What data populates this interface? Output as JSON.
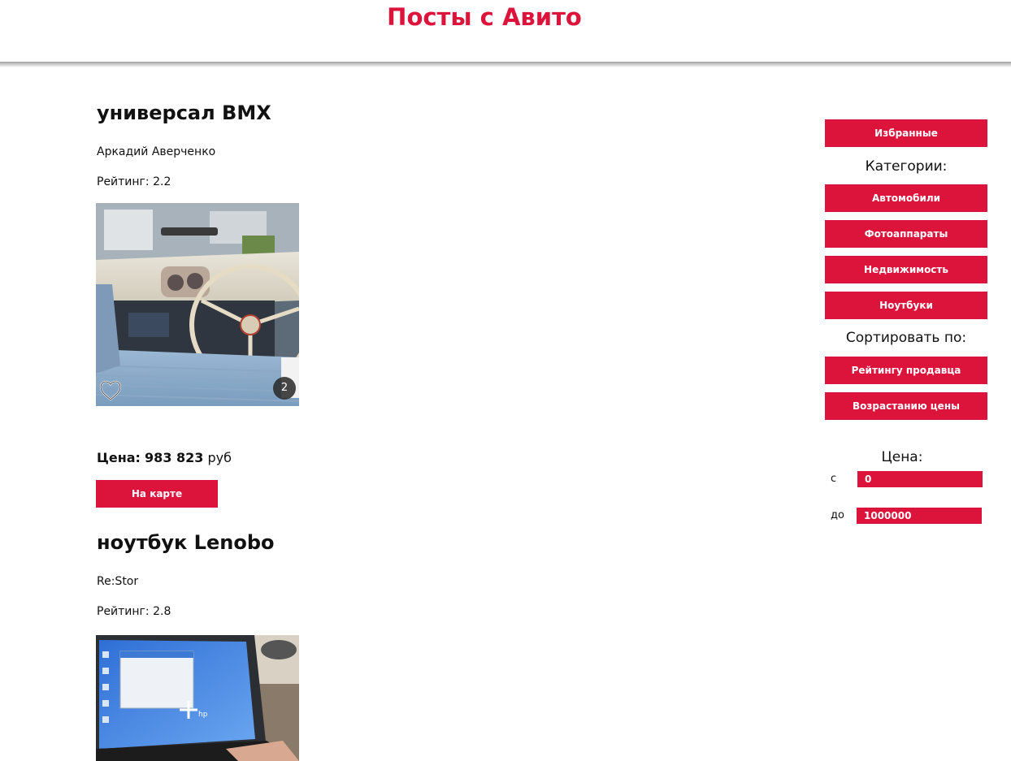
{
  "header": {
    "title": "Посты с Авито"
  },
  "posts": [
    {
      "title": "универсал BMX",
      "author": "Аркадий Аверченко",
      "rating_label": "Рейтинг: 2.2",
      "photo_count": "2",
      "price_label": "Цена:",
      "price_value": "983 823",
      "price_unit": "руб",
      "map_button": "На карте"
    },
    {
      "title": "ноутбук Lenobo",
      "author": "Re:Stor",
      "rating_label": "Рейтинг: 2.8"
    }
  ],
  "sidebar": {
    "favorites_button": "Избранные",
    "categories_heading": "Категории:",
    "categories": [
      "Автомобили",
      "Фотоаппараты",
      "Недвижимость",
      "Ноутбуки"
    ],
    "sort_heading": "Сортировать по:",
    "sort_options": [
      "Рейтингу продавца",
      "Возрастанию цены"
    ],
    "price_heading": "Цена:",
    "price_from_label": "с",
    "price_from_value": "0",
    "price_to_label": "до",
    "price_to_value": "1000000"
  },
  "colors": {
    "accent": "#dc143c",
    "button_text": "#ffffff"
  },
  "icons": {
    "favorite": "heart-icon"
  }
}
